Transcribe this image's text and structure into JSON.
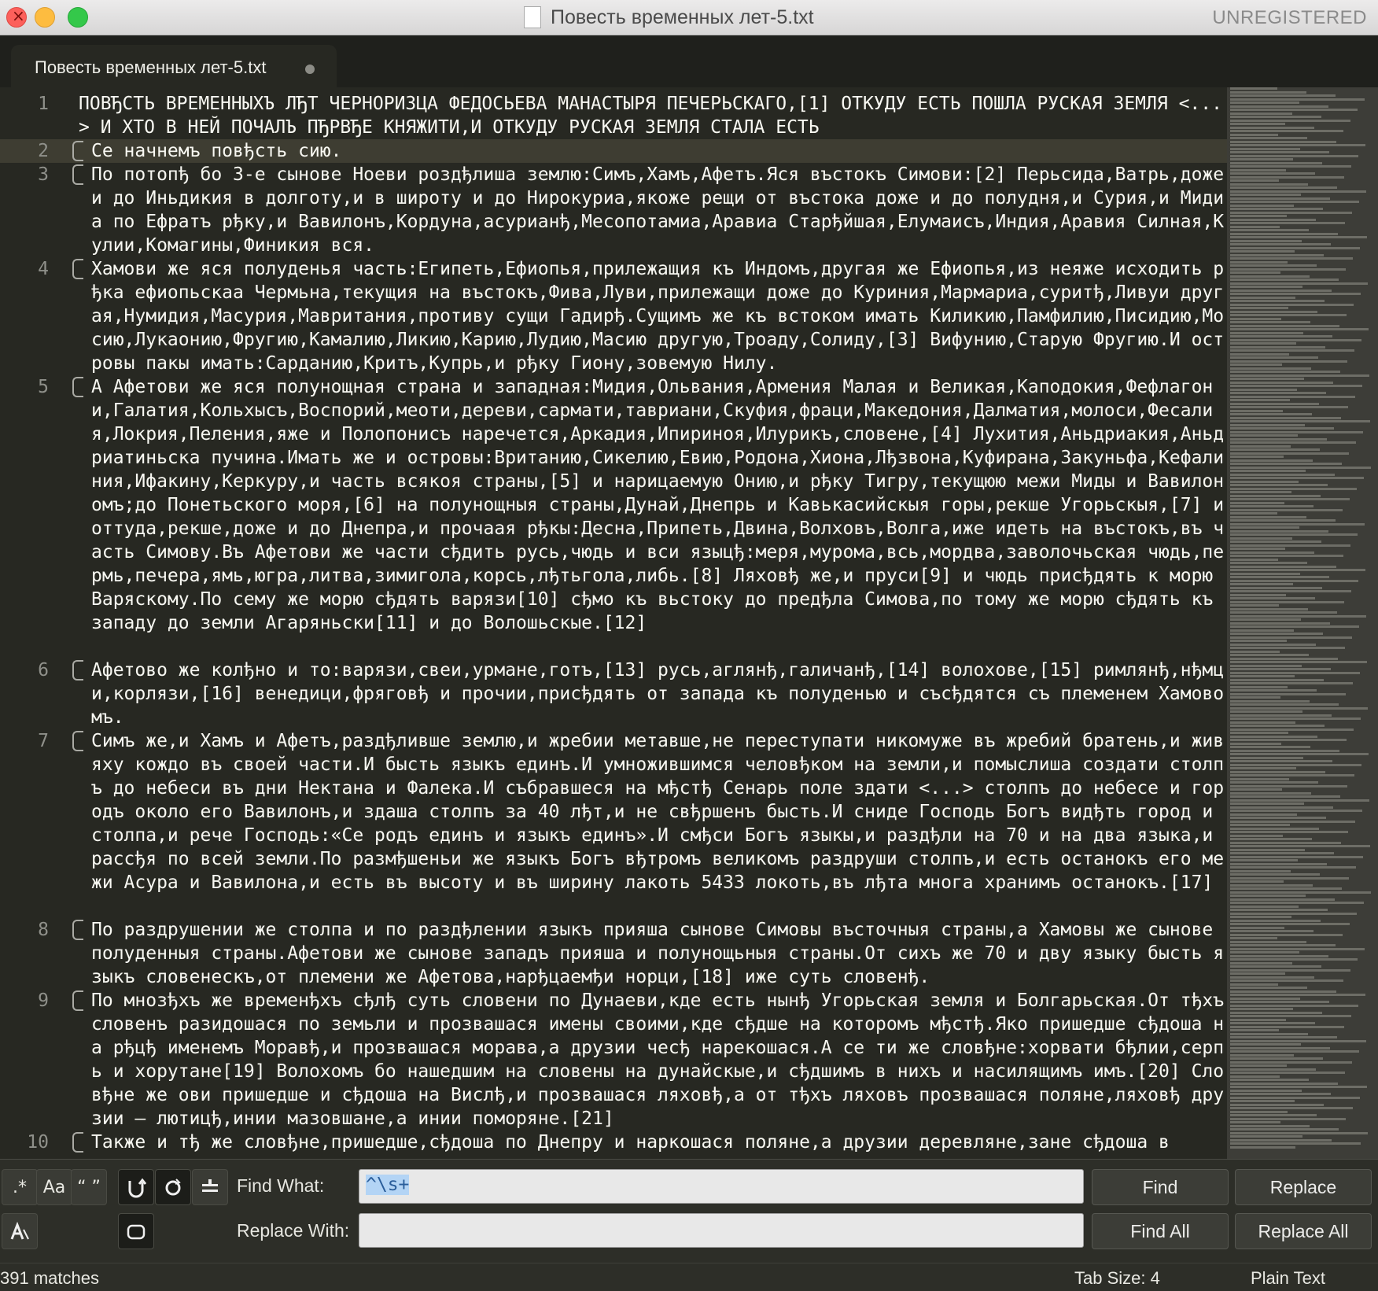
{
  "window": {
    "title": "Повесть временных лет-5.txt",
    "unregistered": "UNREGISTERED"
  },
  "tab": {
    "label": "Повесть временных лет-5.txt"
  },
  "editor": {
    "lines": [
      {
        "no": "1",
        "text": "ПОВЂСТЬ ВРЕМЕННЫХЪ ЛЂТ ЧЕРНОРИЗЦА ФЕДОСЬЕВА МАНАСТЫРЯ ПЕЧЕРЬСКАГО,[1] ОТКУДУ ЕСТЬ ПОШЛА РУСКАЯ ЗЕМЛЯ <...> И ХТО В НЕЙ ПОЧАЛЪ ПЂРВЂЕ КНЯЖИТИ,И ОТКУДУ РУСКАЯ ЗЕМЛЯ СТАЛА ЕСТЬ"
      },
      {
        "no": "2",
        "text": "Се начнемъ повђсть сию."
      },
      {
        "no": "3",
        "text": "По потопђ бо 3-е сынове Ноеви роздђлиша землю:Симъ,Хамъ,Афетъ.Яся въстокъ Симови:[2] Перьсида,Ватрь,доже и до Иньдикия в долготу,и в широту и до Нирокуриа,якоже рещи от въстока доже и до полудня,и Сурия,и Мидиа по Ефратъ рђку,и Вавилонъ,Кордуна,асурианђ,Месопотамиа,Аравиа Старђйшая,Елумаисъ,Индия,Аравия Силная,Кулии,Комагины,Финикия вся."
      },
      {
        "no": "4",
        "text": "Хамови же яся полуденья часть:Египеть,Ефиопья,прилежащия къ Индомъ,другая же Ефиопья,из неяже исходить рђка ефиопьскаа Чермьна,текущия на въстокъ,Фива,Луви,прилежащи доже до Куриния,Мармариа,суритђ,Ливуи другая,Нумидия,Масурия,Мавритания,противу сущи Гадирђ.Сущимъ же къ встоком имать Киликию,Памфилию,Писидию,Мосию,Лукаонию,Фругию,Камалию,Ликию,Карию,Лудию,Масию другую,Троаду,Солиду,[3] Вифунию,Старую Фругию.И островы пакы имать:Сарданию,Критъ,Купрь,и рђку Гиону,зовемую Нилу."
      },
      {
        "no": "5",
        "text": "А Афетови же яся полунощная страна и западная:Мидия,Ольвания,Армения Малая и Великая,Каподокия,Фефлагони,Галатия,Кольхысъ,Воспорий,меоти,дереви,сармати,тавриани,Скуфия,фраци,Македония,Далматия,молоси,Фесалия,Локрия,Пеления,яже и Полопонисъ наречется,Аркадия,Ипириноя,Илурикъ,словене,[4] Лухития,Аньдриакия,Аньдриатиньска пучина.Имать же и островы:Вританию,Сикелию,Евию,Родона,Хиона,Лђзвона,Куфирана,Закуньфа,Кефалиния,Ифакину,Керкуру,и часть всякоя страны,[5] и нарицаемую Онию,и рђку Тигру,текущюю межи Миды и Вавилономъ;до Понетьского моря,[6] на полунощныя страны,Дунай,Днепрь и Кавькасийскыя горы,рекше Угорьскыя,[7] и оттуда,рекше,доже и до Днепра,и прочаая рђкы:Десна,Припеть,Двина,Волховъ,Волга,иже идеть на въстокъ,въ часть Симову.Въ Афетови же части сђдить русь,чюдь и вси языцђ:меря,мурома,всь,мордва,заволочьская чюдь,пермь,печера,ямь,югра,литва,зимигола,корсь,лђтьгола,либь.[8] Ляховђ же,и пруси[9] и чюдь присђдять к морю Варяскому.По сему же морю сђдять варязи[10] сђмо къ вьстоку до предђла Симова,по тому же морю сђдять къ западу до земли Агаряньски[11] и до Волошьскые.[12]"
      },
      {
        "no": "6",
        "text": "Афетово же колђно и то:варязи,свеи,урмане,готъ,[13] русь,аглянђ,галичанђ,[14] волохове,[15] римлянђ,нђмци,корлязи,[16] венедици,фряговђ и прочии,присђдять от запада къ полуденью и съсђдятся съ племенем Хамовомъ."
      },
      {
        "no": "7",
        "text": "Симъ же,и Хамъ и Афетъ,раздђливше землю,и жребии метавше,не переступати никомуже въ жребий братень,и живяху кождо въ своей части.И бысть языкъ единъ.И умножившимся человђком на земли,и помыслиша создати столпъ до небеси въ дни Нектана и Фалека.И събравшеся на мђстђ Сенарь поле здати <...> столпъ до небесе и городъ около его Вавилонъ,и здаша столпъ за 40 лђт,и не свђршенъ бысть.И сниде Господь Богъ видђть город и столпа,и рече Господь:«Се родъ единъ и языкъ единъ».И смђси Богъ языкы,и раздђли на 70 и на два языка,и рассђя по всей земли.По размђшеньи же языкъ Богъ вђтромъ великомъ раздруши столпъ,и есть останокъ его межи Асура и Вавилона,и есть въ высоту и въ ширину лакоть 5433 локоть,въ лђта многа хранимъ останокъ.[17]"
      },
      {
        "no": "8",
        "text": "По раздрушении же столпа и по раздђлении языкъ прияша сынове Симовы въсточныя страны,а Хамовы же сынове полуденныя страны.Афетови же сынове западъ прияша и полунощьныя страны.От сихъ же 70 и дву языку бысть языкъ словенескъ,от племени же Афетова,нарђцаемђи норци,[18] иже суть словенђ."
      },
      {
        "no": "9",
        "text": "По мнозђхъ же временђхъ сђлђ суть словени по Дунаеви,кде есть нынђ Угорьская земля и Болгарьская.От тђхъ словенъ разидошася по земьли и прозвашася имены своими,кде сђдше на которомъ мђстђ.Яко пришедше сђдоша на рђцђ именемъ Моравђ,и прозвашася морава,а друзии чесђ нарекошася.А се ти же словђне:хорвати бђлии,серпь и хорутане[19] Волохомъ бо нашедшим на словены на дунайскые,и сђдшимъ в нихъ и насилящимъ имъ.[20] Словђне же ови пришедше и сђдоша на Вислђ,и прозвашася ляховђ,а от тђхъ ляховъ прозвашася поляне,ляховђ друзии — лютицђ,инии мазовшане,а инии поморяне.[21]"
      },
      {
        "no": "10",
        "text": "Также и тђ же словђне,пришедше,сђдоша по Днепру и наркошася поляне,а друзии деревляне,зане сђдоша в"
      }
    ]
  },
  "find_panel": {
    "find_label": "Find What:",
    "find_value": "^\\s+",
    "replace_label": "Replace With:",
    "replace_value": "",
    "find_button": "Find",
    "replace_button": "Replace",
    "find_all_button": "Find All",
    "replace_all_button": "Replace All",
    "regex_toggle": ".*",
    "case_toggle": "Aa",
    "word_toggle": "“ ”"
  },
  "status": {
    "matches": "391 matches",
    "tab_size": "Tab Size: 4",
    "syntax": "Plain Text"
  },
  "colors": {
    "editor_bg": "#272822",
    "text": "#f8f8f2",
    "gutter_text": "#8f908a",
    "line_highlight": "#3e3d32"
  }
}
